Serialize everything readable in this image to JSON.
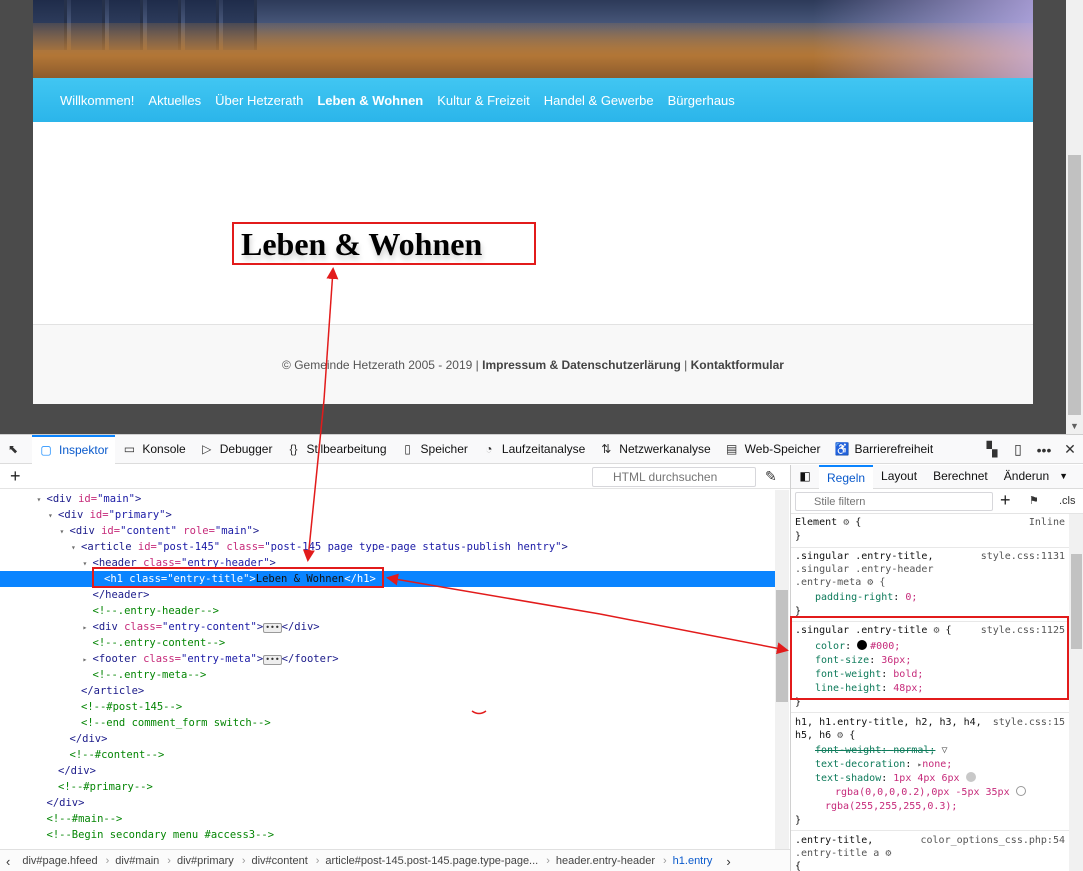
{
  "site": {
    "nav": [
      "Willkommen!",
      "Aktuelles",
      "Über Hetzerath",
      "Leben & Wohnen",
      "Kultur & Freizeit",
      "Handel & Gewerbe",
      "Bürgerhaus"
    ],
    "active_nav": "Leben & Wohnen",
    "entry_title": "Leben & Wohnen",
    "footer_prefix": "© Gemeinde Hetzerath 2005 - 2019 |",
    "footer_link1": "Impressum & Datenschutzerlärung",
    "footer_sep": "|",
    "footer_link2": "Kontaktformular"
  },
  "toolbar": {
    "tabs": [
      "Inspektor",
      "Konsole",
      "Debugger",
      "Stilbearbeitung",
      "Speicher",
      "Laufzeitanalyse",
      "Netzwerkanalyse",
      "Web-Speicher",
      "Barrierefreiheit"
    ],
    "active": "Inspektor"
  },
  "markup": {
    "search_placeholder": "HTML durchsuchen",
    "lines": [
      {
        "i": 3,
        "tw": "▾",
        "parts": [
          [
            "tag",
            "<div "
          ],
          [
            "attr",
            "id="
          ],
          [
            "val",
            "\"main\""
          ],
          [
            "tag",
            ">"
          ]
        ]
      },
      {
        "i": 4,
        "tw": "▾",
        "parts": [
          [
            "tag",
            "<div "
          ],
          [
            "attr",
            "id="
          ],
          [
            "val",
            "\"primary\""
          ],
          [
            "tag",
            ">"
          ]
        ]
      },
      {
        "i": 5,
        "tw": "▾",
        "parts": [
          [
            "tag",
            "<div "
          ],
          [
            "attr",
            "id="
          ],
          [
            "val",
            "\"content\""
          ],
          [
            "attr",
            " role="
          ],
          [
            "val",
            "\"main\""
          ],
          [
            "tag",
            ">"
          ]
        ]
      },
      {
        "i": 6,
        "tw": "▾",
        "parts": [
          [
            "tag",
            "<article "
          ],
          [
            "attr",
            "id="
          ],
          [
            "val",
            "\"post-145\""
          ],
          [
            "attr",
            " class="
          ],
          [
            "val",
            "\"post-145 page type-page status-publish hentry\""
          ],
          [
            "tag",
            ">"
          ]
        ]
      },
      {
        "i": 7,
        "tw": "▾",
        "parts": [
          [
            "tag",
            "<header "
          ],
          [
            "attr",
            "class="
          ],
          [
            "val",
            "\"entry-header\""
          ],
          [
            "tag",
            ">"
          ]
        ]
      },
      {
        "i": 8,
        "tw": "",
        "sel": true,
        "parts": [
          [
            "tag",
            "<h1 "
          ],
          [
            "attr",
            "class="
          ],
          [
            "val",
            "\"entry-title\""
          ],
          [
            "tag",
            ">"
          ],
          [
            "txt",
            "Leben & Wohnen"
          ],
          [
            "tag",
            "</h1>"
          ]
        ]
      },
      {
        "i": 7,
        "tw": "",
        "parts": [
          [
            "tag",
            "</header>"
          ]
        ]
      },
      {
        "i": 7,
        "tw": "",
        "parts": [
          [
            "cmt",
            "<!--.entry-header-->"
          ]
        ]
      },
      {
        "i": 7,
        "tw": "▸",
        "dots": true,
        "parts": [
          [
            "tag",
            "<div "
          ],
          [
            "attr",
            "class="
          ],
          [
            "val",
            "\"entry-content\""
          ],
          [
            "tag",
            ">"
          ],
          [
            "dots",
            ""
          ],
          [
            "tag",
            "</div>"
          ]
        ]
      },
      {
        "i": 7,
        "tw": "",
        "parts": [
          [
            "cmt",
            "<!--.entry-content-->"
          ]
        ]
      },
      {
        "i": 7,
        "tw": "▸",
        "parts": [
          [
            "tag",
            "<footer "
          ],
          [
            "attr",
            "class="
          ],
          [
            "val",
            "\"entry-meta\""
          ],
          [
            "tag",
            ">"
          ],
          [
            "dots",
            ""
          ],
          [
            "tag",
            "</footer>"
          ]
        ]
      },
      {
        "i": 7,
        "tw": "",
        "parts": [
          [
            "cmt",
            "<!--.entry-meta-->"
          ]
        ]
      },
      {
        "i": 6,
        "tw": "",
        "parts": [
          [
            "tag",
            "</article>"
          ]
        ]
      },
      {
        "i": 6,
        "tw": "",
        "parts": [
          [
            "cmt",
            "<!--#post-145-->"
          ]
        ]
      },
      {
        "i": 6,
        "tw": "",
        "parts": [
          [
            "cmt",
            "<!--end comment_form switch-->"
          ]
        ]
      },
      {
        "i": 5,
        "tw": "",
        "parts": [
          [
            "tag",
            "</div>"
          ]
        ]
      },
      {
        "i": 5,
        "tw": "",
        "parts": [
          [
            "cmt",
            "<!--#content-->"
          ]
        ]
      },
      {
        "i": 4,
        "tw": "",
        "parts": [
          [
            "tag",
            "</div>"
          ]
        ]
      },
      {
        "i": 4,
        "tw": "",
        "parts": [
          [
            "cmt",
            "<!--#primary-->"
          ]
        ]
      },
      {
        "i": 3,
        "tw": "",
        "parts": [
          [
            "tag",
            "</div>"
          ]
        ]
      },
      {
        "i": 3,
        "tw": "",
        "parts": [
          [
            "cmt",
            "<!--#main-->"
          ]
        ]
      },
      {
        "i": 3,
        "tw": "",
        "parts": [
          [
            "cmt",
            "<!--Begin secondary menu #access3-->"
          ]
        ]
      }
    ]
  },
  "breadcrumbs": [
    "div#page.hfeed",
    "div#main",
    "div#primary",
    "div#content",
    "article#post-145.post-145.page.type-page...",
    "header.entry-header",
    "h1.entry"
  ],
  "rules_panel": {
    "tabs": [
      "Regeln",
      "Layout",
      "Berechnet",
      "Änderun"
    ],
    "active": "Regeln",
    "filter_placeholder": "Stile filtern",
    "cls_label": ".cls",
    "element_label": "Element",
    "inline_label": "Inline",
    "rule1": {
      "sel1": ".singular .entry-title,",
      "sel2": ".singular .entry-header",
      "sel3": ".entry-meta",
      "src": "style.css:1131",
      "prop": "padding-right",
      "val": "0;"
    },
    "rule2": {
      "sel": ".singular .entry-title",
      "src": "style.css:1125",
      "p1": "color",
      "v1": "#000;",
      "p2": "font-size",
      "v2": "36px;",
      "p3": "font-weight",
      "v3": "bold;",
      "p4": "line-height",
      "v4": "48px;"
    },
    "rule3": {
      "sel1": "h1, h1.entry-title, h2, h3, h4,",
      "sel2": "h5, h6",
      "src": "style.css:15",
      "p1": "font-weight",
      "v1": "normal;",
      "p2": "text-decoration",
      "v2": "none;",
      "p3": "text-shadow",
      "v3": "1px 4px 6px",
      "v3b": "rgba(0,0,0,0.2),0px -5px 35px",
      "v3c": "rgba(255,255,255,0.3);"
    },
    "rule4": {
      "sel1": ".entry-title,",
      "sel2": ".entry-title a",
      "src": "color_options_css.php:54"
    }
  },
  "colors": {
    "nav": "#2bb5ea",
    "highlight": "#e21b1b",
    "selection": "#0a84ff"
  }
}
